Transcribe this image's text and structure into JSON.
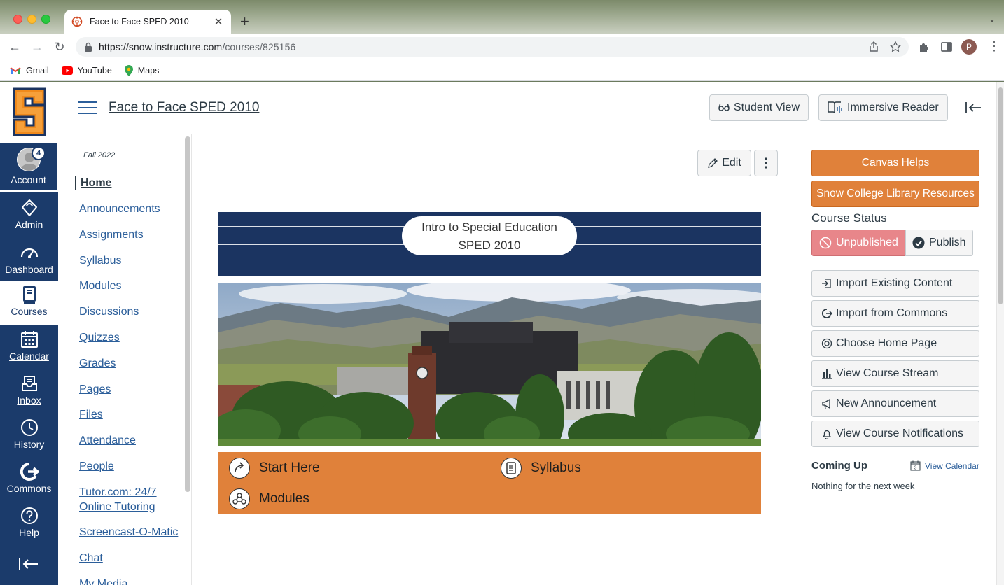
{
  "browser": {
    "tab_title": "Face to Face SPED 2010",
    "url_host": "https://snow.instructure.com",
    "url_path": "/courses/825156",
    "profile_initial": "P",
    "bookmarks": [
      "Gmail",
      "YouTube",
      "Maps"
    ]
  },
  "global_nav": {
    "account": {
      "label": "Account",
      "badge": "4"
    },
    "items": [
      "Admin",
      "Dashboard",
      "Courses",
      "Calendar",
      "Inbox",
      "History",
      "Commons",
      "Help"
    ]
  },
  "header": {
    "course_title": "Face to Face SPED 2010",
    "student_view": "Student View",
    "immersive_reader": "Immersive Reader"
  },
  "course_nav": {
    "term": "Fall 2022",
    "links": [
      "Home",
      "Announcements",
      "Assignments",
      "Syllabus",
      "Modules",
      "Discussions",
      "Quizzes",
      "Grades",
      "Pages",
      "Files",
      "Attendance",
      "People",
      "Tutor.com: 24/7 Online Tutoring",
      "Screencast-O-Matic",
      "Chat",
      "My Media"
    ]
  },
  "content": {
    "edit_label": "Edit",
    "banner_line1": "Intro to Special Education",
    "banner_line2": "SPED 2010",
    "quick_links": [
      "Start Here",
      "Syllabus",
      "Modules"
    ]
  },
  "sidebar": {
    "canvas_helps": "Canvas Helps",
    "library": "Snow College Library Resources",
    "course_status": "Course Status",
    "unpublished": "Unpublished",
    "publish": "Publish",
    "actions": [
      "Import Existing Content",
      "Import from Commons",
      "Choose Home Page",
      "View Course Stream",
      "New Announcement",
      "View Course Notifications"
    ],
    "coming_up": "Coming Up",
    "view_calendar": "View Calendar",
    "calendar_day": "3",
    "nothing": "Nothing for the next week"
  },
  "colors": {
    "canvas_nav": "#1b3b6b",
    "accent_orange": "#e0813a",
    "link_blue": "#2b5e9a",
    "unpublished_red": "#e8868a"
  }
}
